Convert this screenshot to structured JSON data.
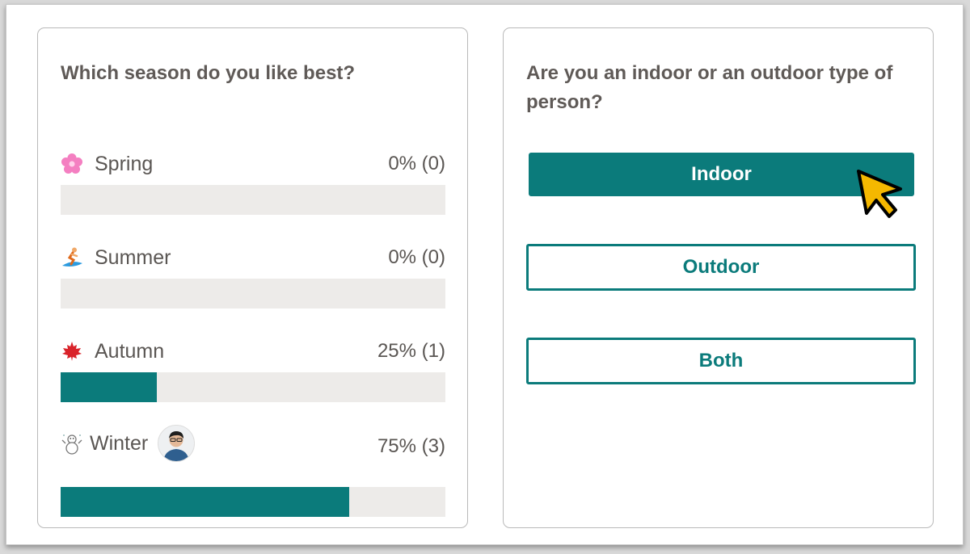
{
  "poll_left": {
    "question": "Which season do you like best?",
    "options": [
      {
        "label": "Spring",
        "result": "0% (0)",
        "percent": 0,
        "icon": "cherry-blossom-icon"
      },
      {
        "label": "Summer",
        "result": "0% (0)",
        "percent": 0,
        "icon": "surfer-icon"
      },
      {
        "label": "Autumn",
        "result": "25% (1)",
        "percent": 25,
        "icon": "maple-leaf-icon"
      },
      {
        "label": "Winter",
        "result": "75% (3)",
        "percent": 75,
        "icon": "snowman-icon"
      }
    ]
  },
  "poll_right": {
    "question": "Are you an indoor or an outdoor type of person?",
    "choices": [
      {
        "label": "Indoor",
        "selected": true
      },
      {
        "label": "Outdoor",
        "selected": false
      },
      {
        "label": "Both",
        "selected": false
      }
    ]
  },
  "colors": {
    "accent": "#0b7b7b",
    "track": "#edebe9",
    "text": "#5a5653",
    "cursor": "#f5b800"
  }
}
